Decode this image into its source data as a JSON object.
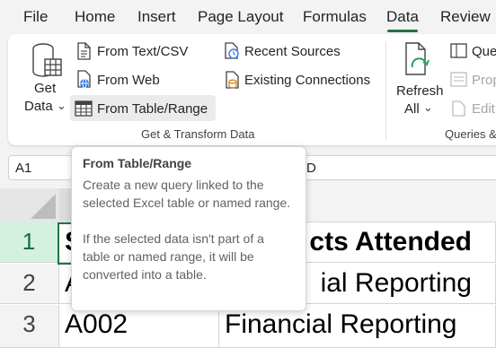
{
  "tabs": [
    "File",
    "Home",
    "Insert",
    "Page Layout",
    "Formulas",
    "Data",
    "Review"
  ],
  "active_tab": "Data",
  "ribbon": {
    "get_data_line1": "Get",
    "get_data_line2": "Data",
    "from_text_csv": "From Text/CSV",
    "from_web": "From Web",
    "from_table_range": "From Table/Range",
    "recent_sources": "Recent Sources",
    "existing_connections": "Existing Connections",
    "group_label": "Get & Transform Data",
    "refresh_line1": "Refresh",
    "refresh_line2": "All",
    "queries_item": "Que",
    "properties_item": "Prop",
    "edit_links_item": "Edit",
    "queries_group_label": "Queries &"
  },
  "name_box": "A1",
  "formula_bar": "D",
  "grid": {
    "rows": [
      "1",
      "2",
      "3"
    ],
    "cells_a": [
      "S",
      "A",
      "A002"
    ],
    "cells_b": [
      "cts Attended",
      "ial Reporting",
      "Financial Reporting"
    ]
  },
  "tooltip": {
    "title": "From Table/Range",
    "para1": "Create a new query linked to the selected Excel table or named range.",
    "para2": "If the selected data isn't part of a table or named range, it will be converted into a table."
  },
  "colors": {
    "accent": "#217346",
    "selected_row_header": "#d3f0e0"
  }
}
